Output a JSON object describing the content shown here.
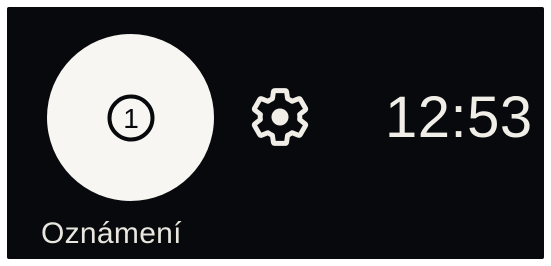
{
  "notifications": {
    "count": "1",
    "label": "Oznámení",
    "icon": "notification-count-icon"
  },
  "settings": {
    "icon": "gear-icon"
  },
  "clock": {
    "time": "12:53"
  },
  "colors": {
    "background": "#07090c",
    "circle": "#f7f6f2",
    "text": "#f1eee8"
  }
}
